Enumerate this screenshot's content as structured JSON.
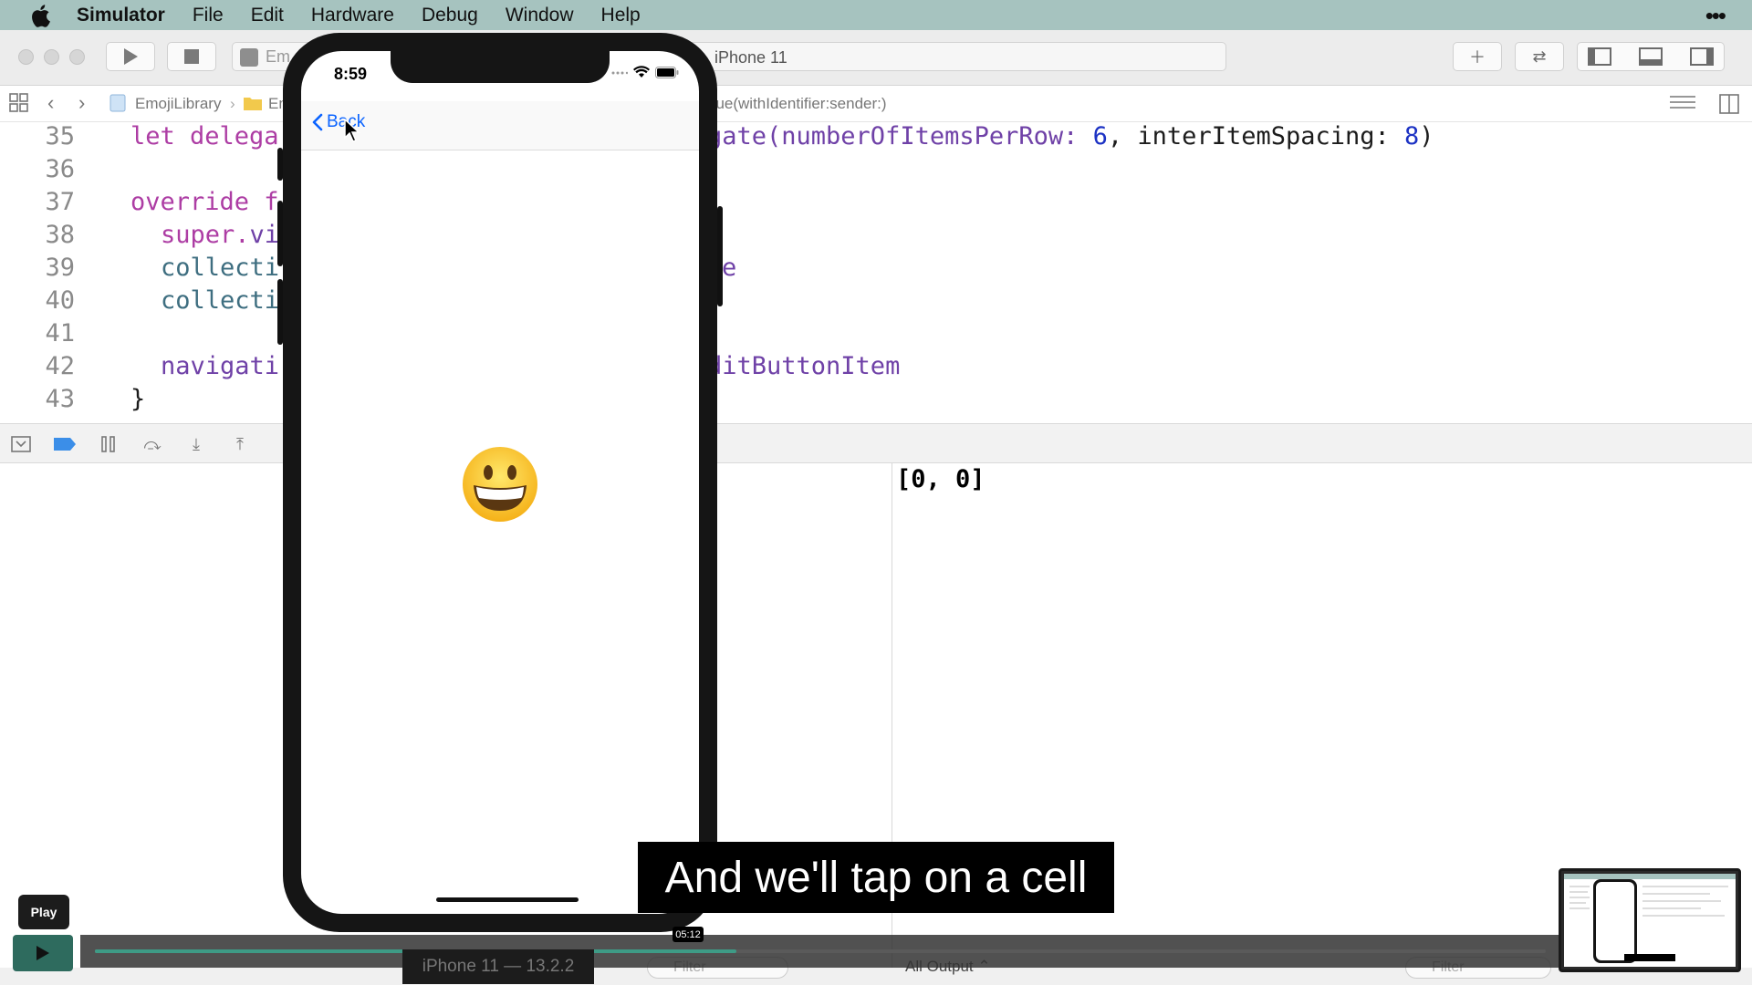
{
  "menubar": {
    "app_name": "Simulator",
    "items": [
      "File",
      "Edit",
      "Hardware",
      "Debug",
      "Window",
      "Help"
    ]
  },
  "toolbar": {
    "scheme_left": "Em",
    "device": "iPhone 11"
  },
  "jumpbar": {
    "project": "EmojiLibrary",
    "folder": "Em",
    "symbol": "gue(withIdentifier:sender:)"
  },
  "editor": {
    "line_numbers": [
      "35",
      "36",
      "37",
      "38",
      "39",
      "40",
      "41",
      "42",
      "43"
    ],
    "line35_a": "let delega",
    "line35_b": "gate(numberOfItemsPerRow: ",
    "line35_c": "6",
    "line35_d": ", interItemSpacing: ",
    "line35_e": "8",
    "line35_f": ")",
    "line37_a": "override f",
    "line38_a": "super.",
    "line38_b": "vi",
    "line39_a": "collecti",
    "line39_b": "e",
    "line40_a": "collecti",
    "line42_a": "navigati",
    "line42_b": "ditButtonItem",
    "line43_a": "}"
  },
  "console": {
    "output": "[0, 0]",
    "all_output": "All Output ⌃",
    "filter_placeholder": "Filter"
  },
  "phone": {
    "time": "8:59",
    "back_label": "Back",
    "emoji": "grinning-face"
  },
  "video": {
    "caption": "And we'll tap on a cell",
    "play_tooltip": "Play",
    "timestamp": "05:12",
    "progress_fraction": 0.442,
    "buffered_fraction": 0.434,
    "device_label": "iPhone 11 — 13.2.2"
  },
  "colors": {
    "menubar_bg": "#a6c3bf",
    "keyword": "#ad3da4",
    "link_blue": "#0a63ff",
    "progress_fill": "#3e9b86"
  }
}
